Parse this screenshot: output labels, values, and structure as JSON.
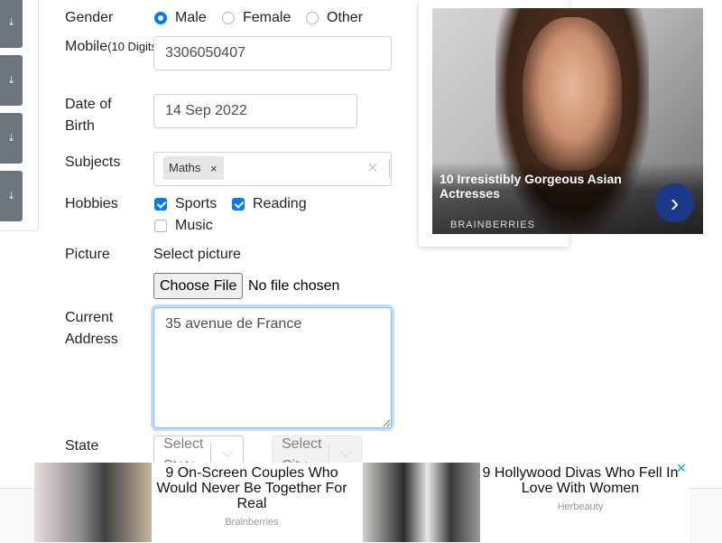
{
  "form": {
    "gender": {
      "label": "Gender",
      "options": [
        {
          "label": "Male",
          "checked": true
        },
        {
          "label": "Female",
          "checked": false
        },
        {
          "label": "Other",
          "checked": false
        }
      ]
    },
    "mobile": {
      "label": "Mobile",
      "hint": "(10 Digits)",
      "value": "3306050407"
    },
    "dob": {
      "label_line1": "Date of",
      "label_line2": "Birth",
      "value": "14 Sep 2022"
    },
    "subjects": {
      "label": "Subjects",
      "chips": [
        "Maths"
      ],
      "chip_remove": "×",
      "clear": "×"
    },
    "hobbies": {
      "label": "Hobbies",
      "options": [
        {
          "label": "Sports",
          "checked": true
        },
        {
          "label": "Reading",
          "checked": true
        },
        {
          "label": "Music",
          "checked": false
        }
      ]
    },
    "picture": {
      "label": "Picture",
      "sublabel": "Select picture",
      "button": "Choose File",
      "status": "No file chosen"
    },
    "address": {
      "label_line1": "Current",
      "label_line2": "Address",
      "value": "35 avenue de France"
    },
    "state": {
      "label": "State",
      "placeholder_state": "Select State",
      "placeholder_city": "Select City"
    }
  },
  "sidebar": {
    "download_icon": "⤓",
    "buttons": 4
  },
  "ad_right": {
    "title": "10 Irresistibly Gorgeous Asian Actresses",
    "brand": "BRAINBERRIES",
    "next_icon": "›"
  },
  "ad_bottom": {
    "items": [
      {
        "title": "9 On-Screen Couples Who Would Never Be Together For Real",
        "source": "Brainberries"
      },
      {
        "title": "9 Hollywood Divas Who Fell In Love With Women",
        "source": "Herbeauty"
      }
    ],
    "close_icon": "✕"
  },
  "colors": {
    "accent": "#007bff",
    "sidebar_button": "#6c757d",
    "ad_next": "#1b3a8c"
  }
}
